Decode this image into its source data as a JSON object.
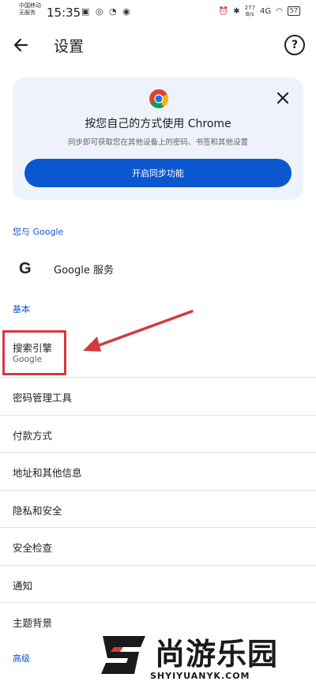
{
  "status_bar": {
    "carrier_line1": "中国移动",
    "carrier_line2": "无服务",
    "time": "15:35",
    "left_icons": "▣ ◎ ◔ ◉",
    "net_speed_value": "277",
    "net_speed_unit": "B/s",
    "signal": "4G",
    "battery": "57"
  },
  "app_bar": {
    "title": "设置",
    "back_icon": "arrow-left",
    "help_icon": "question-circle",
    "help_glyph": "?"
  },
  "sync_card": {
    "title": "按您自己的方式使用 Chrome",
    "subtitle": "同步即可获取您在其他设备上的密码、书签和其他设置",
    "button_label": "开启同步功能",
    "accent_color": "#0b57d0"
  },
  "sections": {
    "you_and_google": "您与 Google",
    "basics": "基本",
    "advanced": "高级"
  },
  "google_services": {
    "icon_glyph": "G",
    "label": "Google 服务"
  },
  "settings": [
    {
      "label": "搜索引擎",
      "sub": "Google"
    },
    {
      "label": "密码管理工具"
    },
    {
      "label": "付款方式"
    },
    {
      "label": "地址和其他信息"
    },
    {
      "label": "隐私和安全"
    },
    {
      "label": "安全检查"
    },
    {
      "label": "通知"
    },
    {
      "label": "主题背景"
    }
  ],
  "watermark": {
    "text": "尚游乐园",
    "url": "SHYIYUANYK.COM"
  },
  "annotation_color": "#d23a3f"
}
